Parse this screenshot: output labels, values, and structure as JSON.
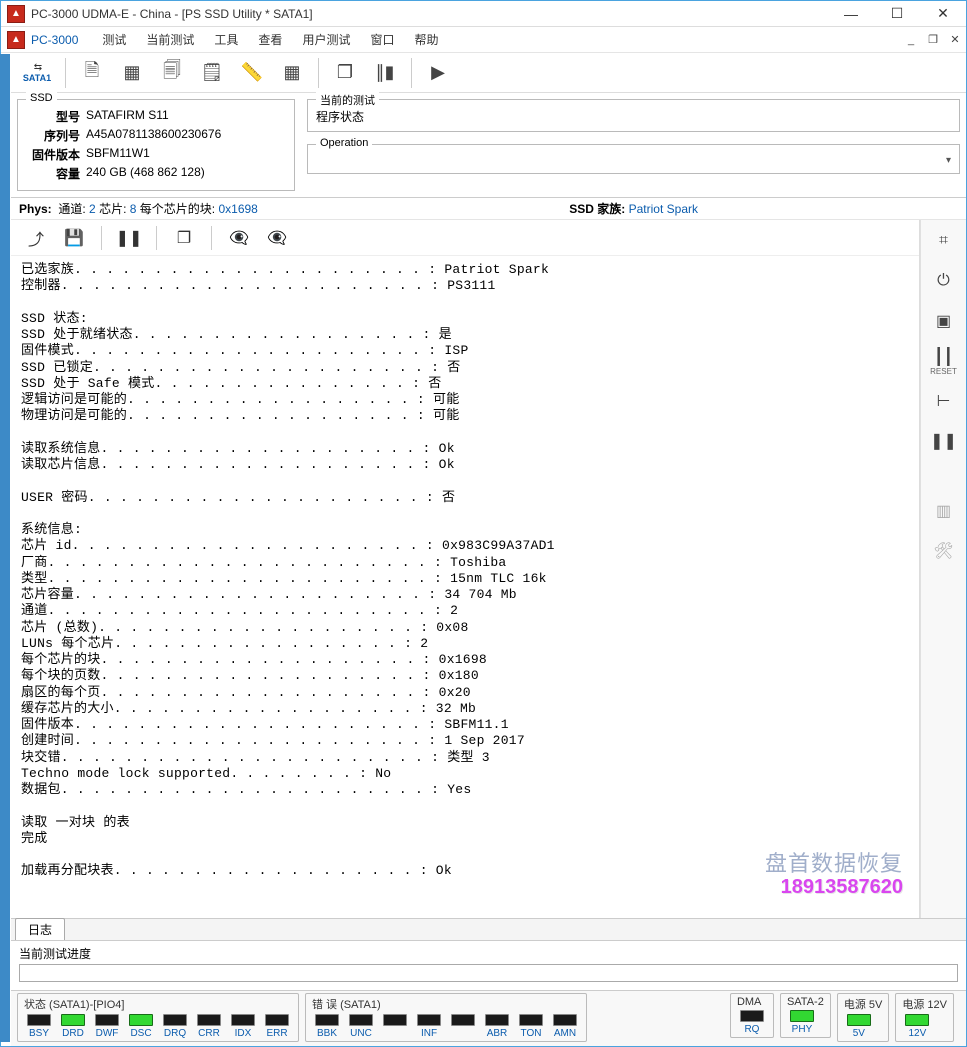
{
  "titlebar": {
    "title": "PC-3000 UDMA-E - China - [PS SSD Utility * SATA1]"
  },
  "menubar": {
    "brand": "PC-3000",
    "items": [
      "测试",
      "当前测试",
      "工具",
      "查看",
      "用户测试",
      "窗口",
      "帮助"
    ]
  },
  "toolbar": {
    "sata_label": "SATA1"
  },
  "ssd_box": {
    "legend": "SSD",
    "rows": {
      "model_lbl": "型号",
      "model_val": "SATAFIRM   S11",
      "serial_lbl": "序列号",
      "serial_val": "A45A0781138600230676",
      "fw_lbl": "固件版本",
      "fw_val": "SBFM11W1",
      "cap_lbl": "容量",
      "cap_val": "240 GB (468 862 128)"
    }
  },
  "current_test": {
    "legend": "当前的测试",
    "status": "程序状态"
  },
  "operation": {
    "legend": "Operation"
  },
  "phys_bar": {
    "phys_label": "Phys:",
    "ch_lbl": "通道:",
    "ch_val": "2",
    "chip_lbl": "芯片:",
    "chip_val": "8",
    "blocks_lbl": "每个芯片的块:",
    "blocks_val": "0x1698",
    "family_lbl": "SSD 家族:",
    "family_val": "Patriot Spark"
  },
  "log_lines": [
    "已选家族. . . . . . . . . . . . . . . . . . . . . . : Patriot Spark",
    "控制器. . . . . . . . . . . . . . . . . . . . . . . : PS3111",
    "",
    "SSD 状态:",
    "SSD 处于就绪状态. . . . . . . . . . . . . . . . . . : 是",
    "固件模式. . . . . . . . . . . . . . . . . . . . . . : ISP",
    "SSD 已锁定. . . . . . . . . . . . . . . . . . . . . : 否",
    "SSD 处于 Safe 模式. . . . . . . . . . . . . . . . : 否",
    "逻辑访问是可能的. . . . . . . . . . . . . . . . . . : 可能",
    "物理访问是可能的. . . . . . . . . . . . . . . . . . : 可能",
    "",
    "读取系统信息. . . . . . . . . . . . . . . . . . . . : Ok",
    "读取芯片信息. . . . . . . . . . . . . . . . . . . . : Ok",
    "",
    "USER 密码. . . . . . . . . . . . . . . . . . . . . : 否",
    "",
    "系统信息:",
    "芯片 id. . . . . . . . . . . . . . . . . . . . . . : 0x983C99A37AD1",
    "厂商. . . . . . . . . . . . . . . . . . . . . . . . : Toshiba",
    "类型. . . . . . . . . . . . . . . . . . . . . . . . : 15nm TLC 16k",
    "芯片容量. . . . . . . . . . . . . . . . . . . . . . : 34 704 Mb",
    "通道. . . . . . . . . . . . . . . . . . . . . . . . : 2",
    "芯片 (总数). . . . . . . . . . . . . . . . . . . . : 0x08",
    "LUNs 每个芯片. . . . . . . . . . . . . . . . . . : 2",
    "每个芯片的块. . . . . . . . . . . . . . . . . . . . : 0x1698",
    "每个块的页数. . . . . . . . . . . . . . . . . . . . : 0x180",
    "扇区的每个页. . . . . . . . . . . . . . . . . . . . : 0x20",
    "缓存芯片的大小. . . . . . . . . . . . . . . . . . . : 32 Mb",
    "固件版本. . . . . . . . . . . . . . . . . . . . . . : SBFM11.1",
    "创建时间. . . . . . . . . . . . . . . . . . . . . . : 1 Sep 2017",
    "块交错. . . . . . . . . . . . . . . . . . . . . . . : 类型 3",
    "Techno mode lock supported. . . . . . . . : No",
    "数据包. . . . . . . . . . . . . . . . . . . . . . . : Yes",
    "",
    "读取 一对块 的表",
    "完成",
    "",
    "加载再分配块表. . . . . . . . . . . . . . . . . . . : Ok"
  ],
  "tabs": {
    "log_tab": "日志"
  },
  "progress": {
    "label": "当前测试进度"
  },
  "watermark": {
    "line1": "盘首数据恢复",
    "line2": "18913587620"
  },
  "status_strip": {
    "group_state": {
      "title": "状态 (SATA1)-[PIO4]",
      "leds": [
        {
          "id": "BSY",
          "on": false
        },
        {
          "id": "DRD",
          "on": true
        },
        {
          "id": "DWF",
          "on": false
        },
        {
          "id": "DSC",
          "on": true
        },
        {
          "id": "DRQ",
          "on": false
        },
        {
          "id": "CRR",
          "on": false
        },
        {
          "id": "IDX",
          "on": false
        },
        {
          "id": "ERR",
          "on": false
        }
      ]
    },
    "group_err": {
      "title": "错 误 (SATA1)",
      "leds": [
        {
          "id": "BBK",
          "on": false
        },
        {
          "id": "UNC",
          "on": false
        },
        {
          "id": "",
          "on": false
        },
        {
          "id": "INF",
          "on": false
        },
        {
          "id": "",
          "on": false
        },
        {
          "id": "ABR",
          "on": false
        },
        {
          "id": "TON",
          "on": false
        },
        {
          "id": "AMN",
          "on": false
        }
      ]
    },
    "group_dma": {
      "title": "DMA",
      "leds": [
        {
          "id": "RQ",
          "on": false
        }
      ]
    },
    "group_sata2": {
      "title": "SATA-2",
      "leds": [
        {
          "id": "PHY",
          "on": true
        }
      ]
    },
    "group_5v": {
      "title": "电源 5V",
      "leds": [
        {
          "id": "5V",
          "on": true
        }
      ]
    },
    "group_12v": {
      "title": "电源 12V",
      "leds": [
        {
          "id": "12V",
          "on": true
        }
      ]
    }
  }
}
